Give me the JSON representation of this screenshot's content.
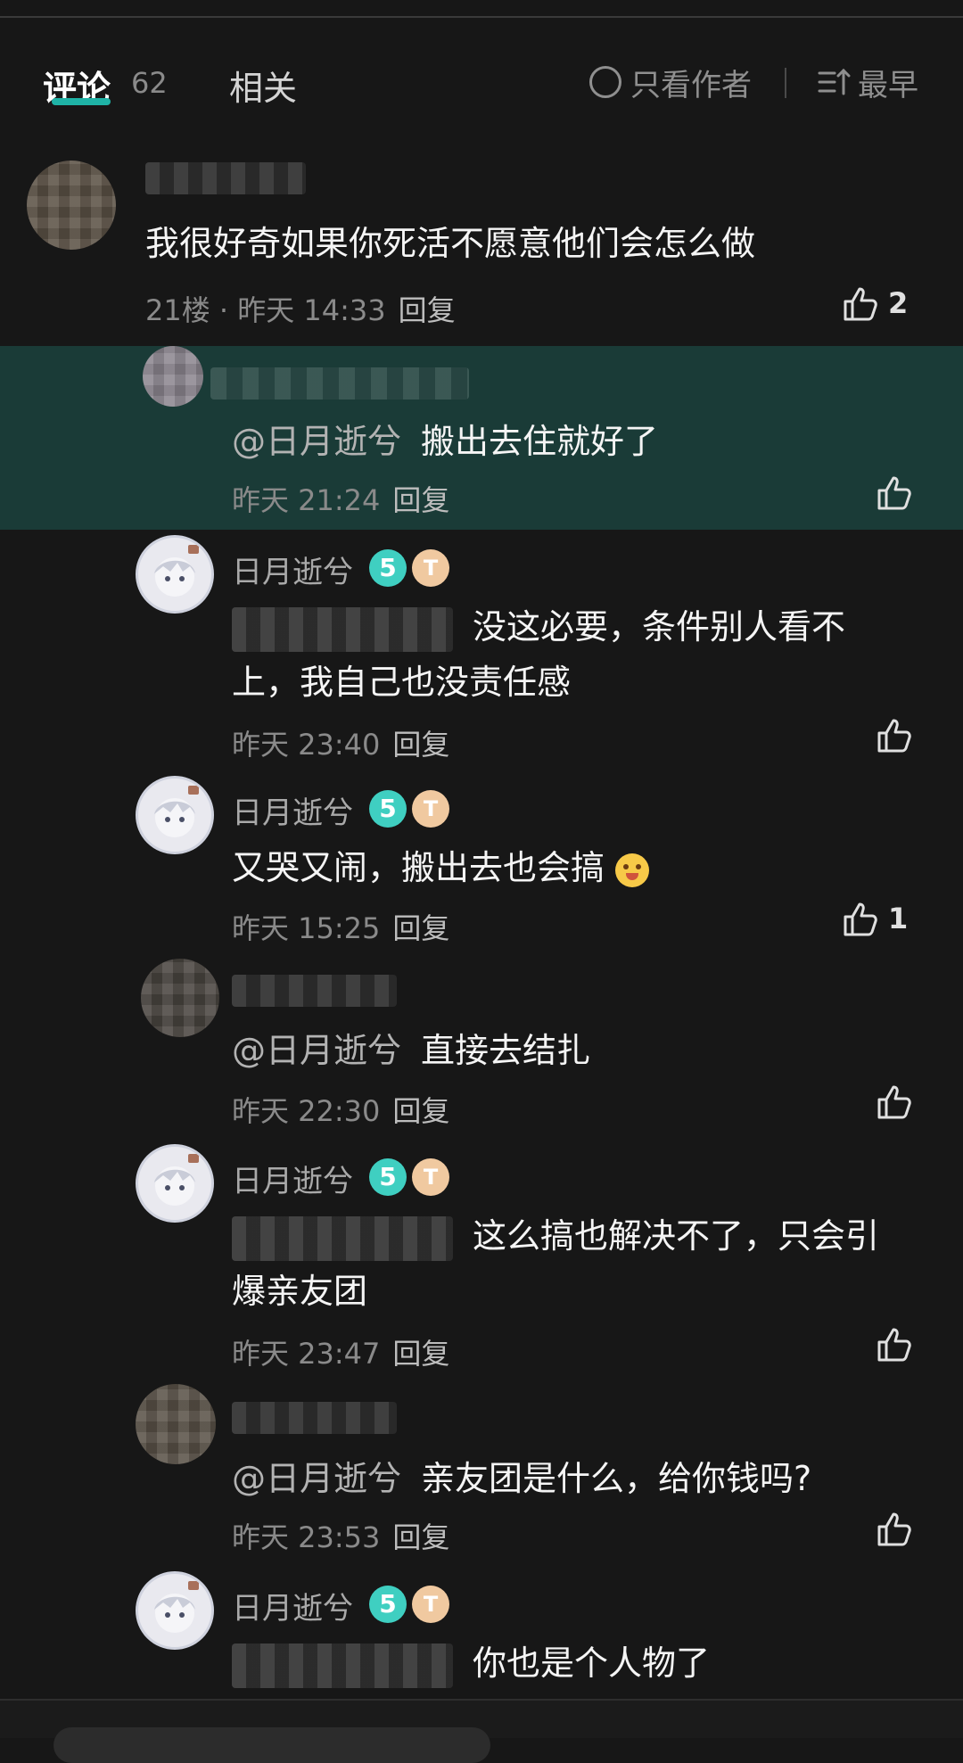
{
  "header": {
    "tab_comments": "评论",
    "comment_count": "62",
    "tab_related": "相关",
    "only_author": "只看作者",
    "sort": "最早"
  },
  "colors": {
    "accent": "#1fb3a6",
    "highlight_bg": "#1a3b37",
    "background": "#171717"
  },
  "comments": [
    {
      "text": "我很好奇如果你死活不愿意他们会怎么做",
      "floor": "21楼 · 昨天 14:33",
      "reply": "回复",
      "likes": "2"
    },
    {
      "mention": "@日月逝兮",
      "text": "搬出去住就好了",
      "time": "昨天 21:24",
      "reply": "回复"
    },
    {
      "username": "日月逝兮",
      "badge_level": "5",
      "badge_t": "T",
      "text": "没这必要，条件别人看不上，我自己也没责任感",
      "time": "昨天 23:40",
      "reply": "回复"
    },
    {
      "username": "日月逝兮",
      "badge_level": "5",
      "badge_t": "T",
      "text": "又哭又闹，搬出去也会搞",
      "time": "昨天 15:25",
      "reply": "回复",
      "likes": "1"
    },
    {
      "mention": "@日月逝兮",
      "text": "直接去结扎",
      "time": "昨天 22:30",
      "reply": "回复"
    },
    {
      "username": "日月逝兮",
      "badge_level": "5",
      "badge_t": "T",
      "text": "这么搞也解决不了，只会引爆亲友团",
      "time": "昨天 23:47",
      "reply": "回复"
    },
    {
      "mention": "@日月逝兮",
      "text": "亲友团是什么，给你钱吗?",
      "time": "昨天 23:53",
      "reply": "回复"
    },
    {
      "username": "日月逝兮",
      "badge_level": "5",
      "badge_t": "T",
      "text": "你也是个人物了"
    }
  ]
}
